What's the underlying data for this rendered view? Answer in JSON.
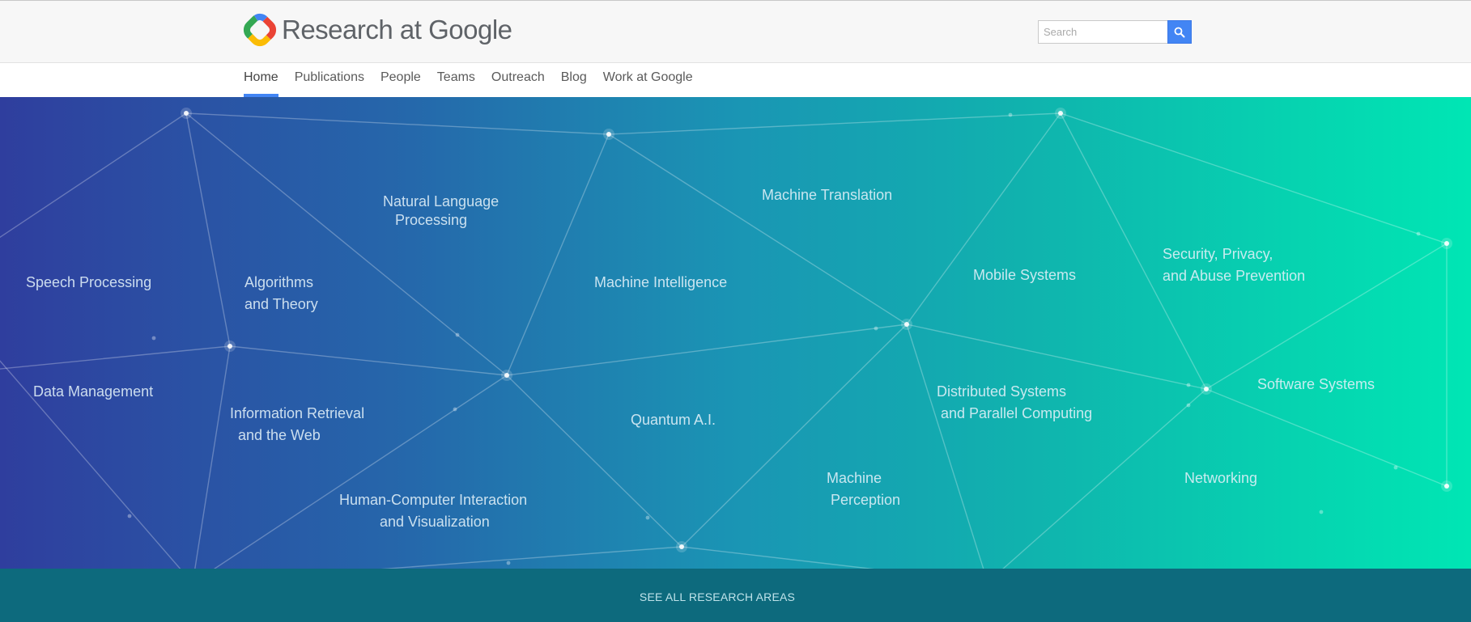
{
  "header": {
    "logo_text": "Research at Google",
    "search": {
      "placeholder": "Search"
    }
  },
  "nav": {
    "items": [
      {
        "label": "Home",
        "active": true
      },
      {
        "label": "Publications"
      },
      {
        "label": "People"
      },
      {
        "label": "Teams"
      },
      {
        "label": "Outreach"
      },
      {
        "label": "Blog"
      },
      {
        "label": "Work at Google"
      }
    ]
  },
  "hero": {
    "areas": [
      {
        "label": "Speech Processing"
      },
      {
        "label": "Data Management"
      },
      {
        "label": "Algorithms\nand Theory"
      },
      {
        "label": "Information Retrieval\n  and the Web"
      },
      {
        "label": "Natural Language\n   Processing"
      },
      {
        "label": "Human-Computer Interaction\n          and Visualization"
      },
      {
        "label": "Machine Translation"
      },
      {
        "label": "Machine Intelligence"
      },
      {
        "label": "Quantum A.I."
      },
      {
        "label": "Machine\n Perception"
      },
      {
        "label": "Mobile Systems"
      },
      {
        "label": "Distributed Systems\n and Parallel Computing"
      },
      {
        "label": "Security, Privacy,\nand Abuse Prevention"
      },
      {
        "label": "Software Systems"
      },
      {
        "label": "Networking"
      }
    ]
  },
  "footer": {
    "see_all_label": "SEE ALL RESEARCH AREAS"
  },
  "colors": {
    "accent": "#4285f4",
    "footer_bar": "#0d6a7d"
  },
  "icons": {
    "search": "search-icon",
    "logo": "google-research-logo-icon"
  }
}
